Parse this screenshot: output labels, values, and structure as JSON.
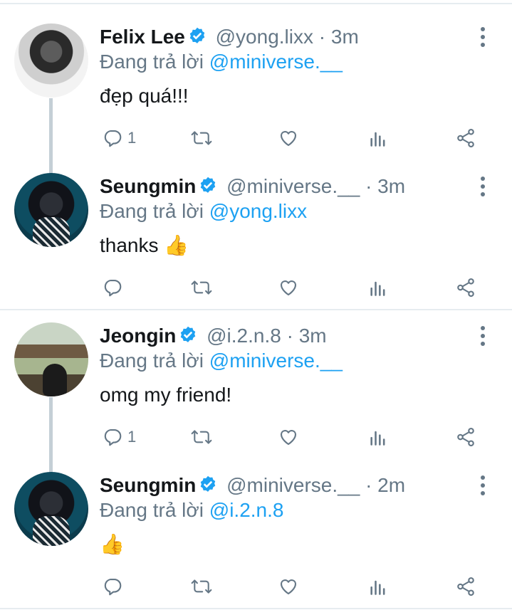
{
  "colors": {
    "link": "#1da1f2",
    "muted": "#657786",
    "text": "#14171a",
    "verified": "#1da1f2",
    "divider": "#e6ecf0"
  },
  "tweets": [
    {
      "name": "Felix Lee",
      "handle": "@yong.lixx",
      "time": "· 3m",
      "reply_prefix": "Đang trả lời",
      "reply_to": "@miniverse.__",
      "text": "đẹp quá!!!",
      "reply_count": "1"
    },
    {
      "name": "Seungmin",
      "handle": "@miniverse.__",
      "time": "· 3m",
      "reply_prefix": "Đang trả lời",
      "reply_to": "@yong.lixx",
      "text": "thanks 👍",
      "reply_count": ""
    },
    {
      "name": "Jeongin",
      "handle": "@i.2.n.8",
      "time": "· 3m",
      "reply_prefix": "Đang trả lời",
      "reply_to": "@miniverse.__",
      "text": "omg my friend!",
      "reply_count": "1"
    },
    {
      "name": "Seungmin",
      "handle": "@miniverse.__",
      "time": "· 2m",
      "reply_prefix": "Đang trả lời",
      "reply_to": "@i.2.n.8",
      "text": "👍",
      "reply_count": ""
    }
  ]
}
